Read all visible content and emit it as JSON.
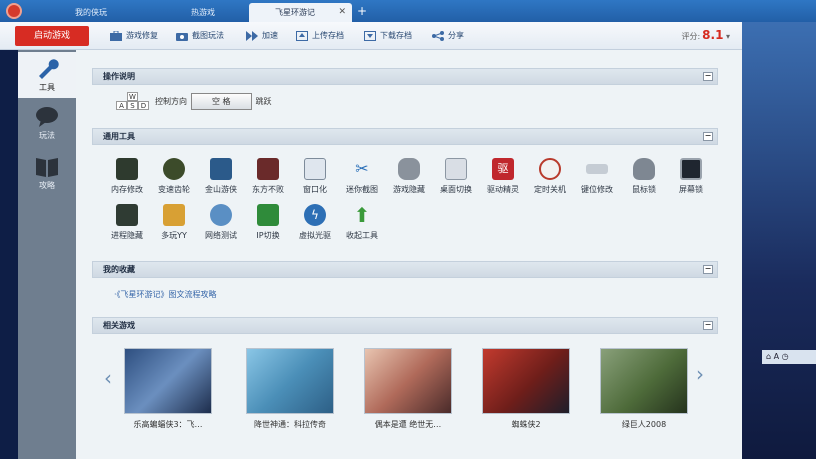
{
  "tabs": {
    "items": [
      {
        "label": "我的侠玩"
      },
      {
        "label": "热游戏"
      },
      {
        "label": "飞星环游记"
      }
    ],
    "add_label": "+",
    "close_label": "✕"
  },
  "toolbar": {
    "start_label": "启动游戏",
    "tools": [
      {
        "label": "游戏修复",
        "icon": "briefcase-icon"
      },
      {
        "label": "截图玩法",
        "icon": "camera-icon"
      },
      {
        "label": "加速",
        "icon": "fast-forward-icon"
      },
      {
        "label": "上传存档",
        "icon": "upload-icon"
      },
      {
        "label": "下载存档",
        "icon": "download-icon"
      },
      {
        "label": "分享",
        "icon": "share-icon"
      }
    ],
    "rating_label": "评分:",
    "rating_value": "8.1",
    "rating_caret": "▾"
  },
  "sidebar": {
    "items": [
      {
        "label": "工具",
        "icon": "wrench-icon"
      },
      {
        "label": "玩法",
        "icon": "chat-bubble-icon"
      },
      {
        "label": "攻略",
        "icon": "book-icon"
      }
    ]
  },
  "panels": {
    "controls": {
      "title": "操作说明",
      "keys": [
        "W",
        "A",
        "S",
        "D"
      ],
      "direction_label": "控制方向",
      "space_label": "空 格",
      "jump_label": "跳跃"
    },
    "tools": {
      "title": "通用工具",
      "items": [
        {
          "label": "内存修改",
          "icon": "memory-icon"
        },
        {
          "label": "变速齿轮",
          "icon": "gear-icon"
        },
        {
          "label": "金山游侠",
          "icon": "jinshan-icon"
        },
        {
          "label": "东方不败",
          "icon": "dongfang-icon"
        },
        {
          "label": "窗口化",
          "icon": "window-icon"
        },
        {
          "label": "迷你截图",
          "icon": "scissors-icon"
        },
        {
          "label": "游戏隐藏",
          "icon": "gamepad-icon"
        },
        {
          "label": "桌面切换",
          "icon": "desktop-switch-icon"
        },
        {
          "label": "驱动精灵",
          "icon": "driver-icon"
        },
        {
          "label": "定时关机",
          "icon": "clock-icon"
        },
        {
          "label": "键位修改",
          "icon": "usb-icon"
        },
        {
          "label": "鼠标锁",
          "icon": "mouse-icon"
        },
        {
          "label": "屏幕锁",
          "icon": "screen-lock-icon"
        },
        {
          "label": "进程隐藏",
          "icon": "process-icon"
        },
        {
          "label": "多玩YY",
          "icon": "yy-icon"
        },
        {
          "label": "网络测试",
          "icon": "network-icon"
        },
        {
          "label": "IP切换",
          "icon": "ip-switch-icon"
        },
        {
          "label": "虚拟光驱",
          "icon": "lightning-icon"
        },
        {
          "label": "收起工具",
          "icon": "up-arrow-icon"
        }
      ]
    },
    "favorites": {
      "title": "我的收藏",
      "link": "·《飞星环游记》图文流程攻略"
    },
    "related": {
      "title": "相关游戏",
      "games": [
        {
          "name": "乐高蝙蝠侠3：飞…",
          "thumb_color": "#3d5f8f"
        },
        {
          "name": "降世神通：科拉传奇",
          "thumb_color": "#5aa0c8"
        },
        {
          "name": "偶本是遭 绝世无…",
          "thumb_color": "#b06a5a"
        },
        {
          "name": "蜘蛛侠2",
          "thumb_color": "#8a2b23"
        },
        {
          "name": "绿巨人2008",
          "thumb_color": "#4e6b3a"
        }
      ],
      "prev_label": "‹",
      "next_label": "›"
    }
  },
  "collapse_label": "−",
  "taskbar": {
    "lang_label": "⌂ A ◷"
  },
  "colors": {
    "accent_red": "#d72c23",
    "rating_red": "#d62a1f",
    "header_blue": "#2f77c4"
  }
}
